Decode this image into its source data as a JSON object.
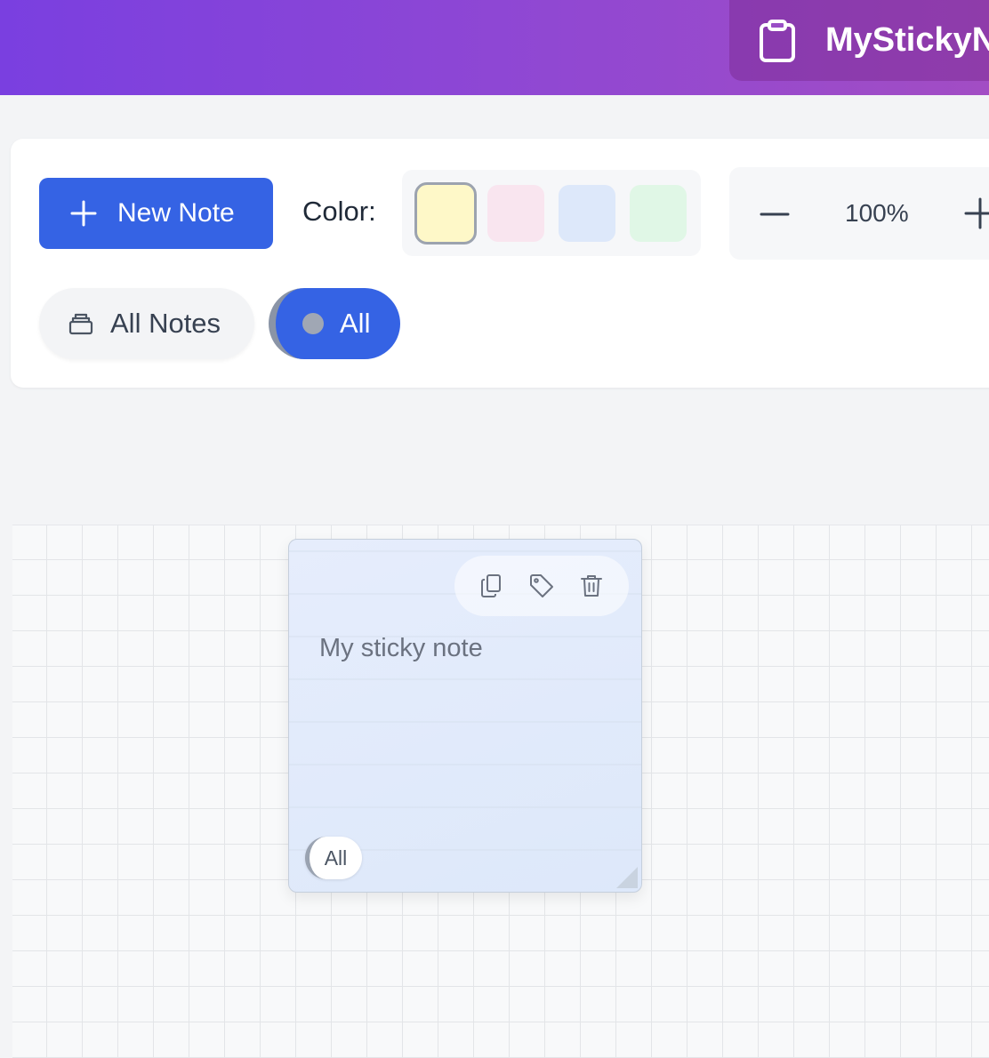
{
  "app": {
    "title": "MyStickyNotes",
    "brand_icon": "clipboard-icon",
    "header_gradient": [
      "#7a3fe0",
      "#a24dc4"
    ]
  },
  "toolbar": {
    "new_note_label": "New Note",
    "new_note_icon": "plus-icon",
    "color_label": "Color:",
    "colors": [
      {
        "name": "yellow",
        "hex": "#fef8c8",
        "selected": true
      },
      {
        "name": "pink",
        "hex": "#f9e5ef",
        "selected": false
      },
      {
        "name": "blue",
        "hex": "#dde8fa",
        "selected": false
      },
      {
        "name": "green",
        "hex": "#e0f7e6",
        "selected": false
      }
    ],
    "zoom_value": "100%",
    "accent": "#3563e4"
  },
  "filters": {
    "all_notes_label": "All Notes",
    "all_notes_icon": "archive-box-icon",
    "all_label": "All"
  },
  "notes": [
    {
      "text": "My sticky note",
      "tag": "All",
      "color": "#dde8fa",
      "actions": [
        "copy-icon",
        "tag-icon",
        "trash-icon"
      ]
    }
  ]
}
